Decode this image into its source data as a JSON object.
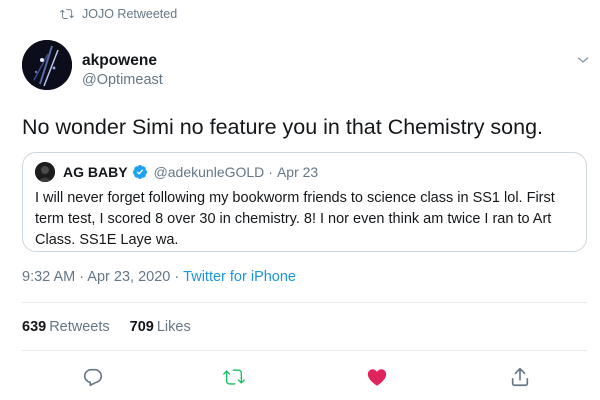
{
  "retweet_banner": {
    "icon": "retweet-icon",
    "text": "JOJO Retweeted"
  },
  "tweet": {
    "author_name": "akpowene",
    "author_handle": "@Optimeast",
    "text": "No wonder Simi no feature you in that Chemistry song.",
    "timestamp": "9:32 AM · Apr 23, 2020",
    "separator": "·",
    "source": "Twitter for iPhone"
  },
  "quote": {
    "author_name": "AG BABY",
    "verified": true,
    "author_handle": "@adekunleGOLD",
    "dot": "·",
    "date": "Apr 23",
    "text": "I will never forget following my bookworm friends to science class in SS1 lol. First term test, I scored 8 over 30 in chemistry. 8! I nor even think am twice I ran to Art Class. SS1E Laye wa."
  },
  "stats": {
    "retweets_count": "639",
    "retweets_label": "Retweets",
    "likes_count": "709",
    "likes_label": "Likes"
  },
  "actions": [
    {
      "name": "reply",
      "icon": "reply-icon",
      "color": "#657786"
    },
    {
      "name": "retweet",
      "icon": "retweet-icon",
      "color": "#17bf63"
    },
    {
      "name": "like",
      "icon": "heart-icon",
      "color": "#e0245e"
    },
    {
      "name": "share",
      "icon": "share-icon",
      "color": "#657786"
    }
  ],
  "colors": {
    "text_primary": "#14171a",
    "text_secondary": "#657786",
    "link": "#1b95e0",
    "verified": "#1da1f2",
    "border": "#ccd6dd"
  }
}
